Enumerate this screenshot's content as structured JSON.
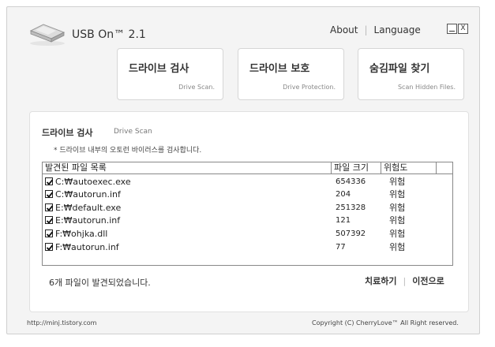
{
  "app": {
    "title": "USB On™ 2.1"
  },
  "top_links": {
    "about": "About",
    "language": "Language"
  },
  "window_controls": {
    "minimize": "_",
    "close": "X"
  },
  "nav": [
    {
      "label": "드라이브 검사",
      "sublabel": "Drive Scan."
    },
    {
      "label": "드라이브 보호",
      "sublabel": "Drive Protection."
    },
    {
      "label": "숨김파일 찾기",
      "sublabel": "Scan Hidden Files."
    }
  ],
  "section": {
    "title": "드라이브 검사",
    "subtitle": "Drive Scan",
    "description": "* 드라이브 내부의 오토런 바이러스를 검사합니다."
  },
  "table": {
    "columns": [
      "발견된 파일 목록",
      "파일 크기",
      "위험도"
    ],
    "rows": [
      {
        "name": "C:₩autoexec.exe",
        "size": "654336",
        "risk": "위험",
        "checked": true
      },
      {
        "name": "C:₩autorun.inf",
        "size": "204",
        "risk": "위험",
        "checked": true
      },
      {
        "name": "E:₩default.exe",
        "size": "251328",
        "risk": "위험",
        "checked": true
      },
      {
        "name": "E:₩autorun.inf",
        "size": "121",
        "risk": "위험",
        "checked": true
      },
      {
        "name": "F:₩ohjka.dll",
        "size": "507392",
        "risk": "위험",
        "checked": true
      },
      {
        "name": "F:₩autorun.inf",
        "size": "77",
        "risk": "위험",
        "checked": true
      }
    ]
  },
  "status": {
    "found_text": "6개 파일이 발견되었습니다."
  },
  "actions": {
    "treat": "치료하기",
    "back": "이전으로"
  },
  "footer": {
    "url": "http://minj.tistory.com",
    "copyright": "Copyright (C) CherryLove™ All Right reserved."
  }
}
